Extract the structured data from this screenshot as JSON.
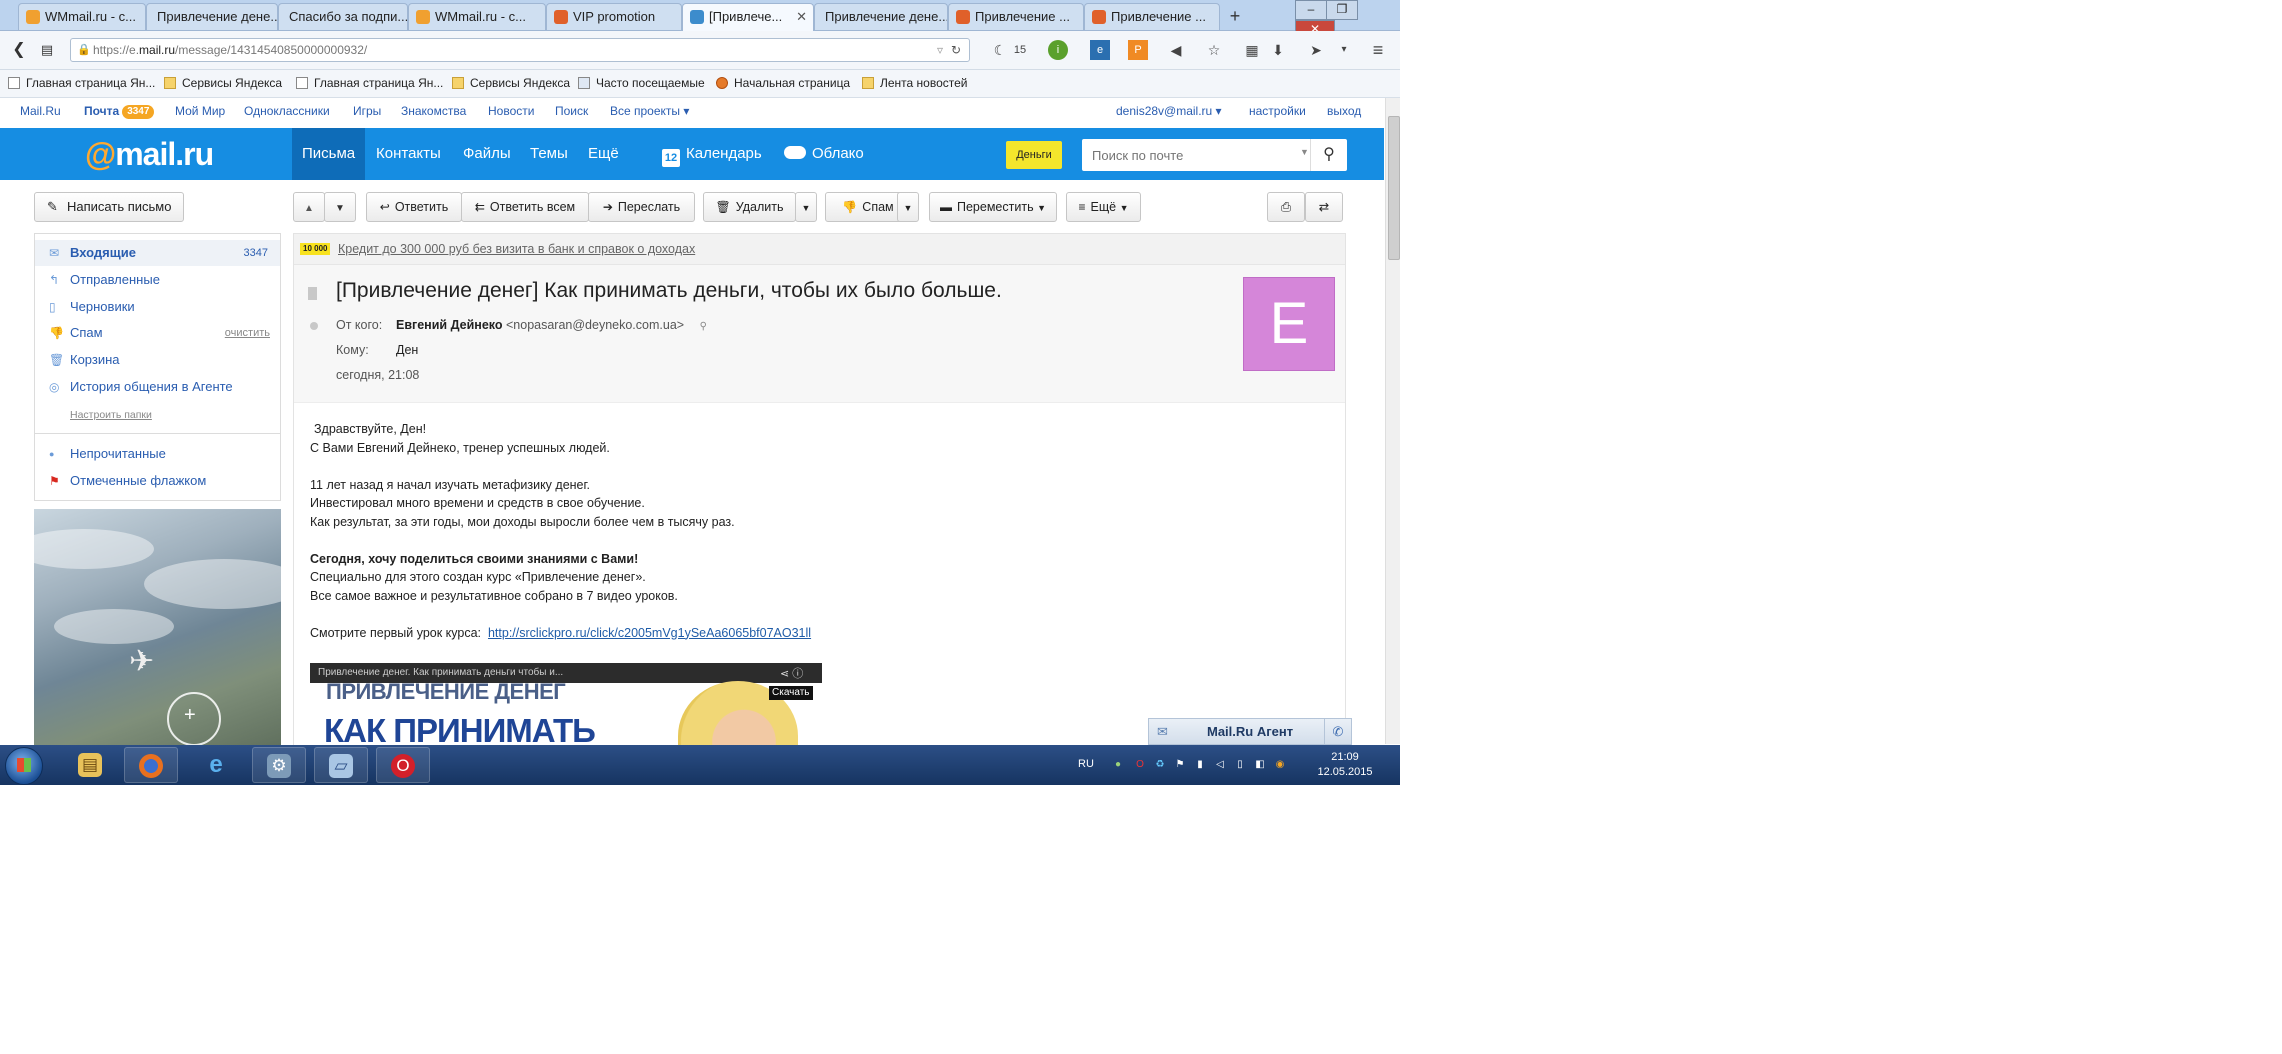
{
  "browser": {
    "tabs": [
      {
        "title": "WMmail.ru - с...",
        "color": "#f0a030"
      },
      {
        "title": "Привлечение дене...",
        "color": ""
      },
      {
        "title": "Спасибо за подпи...",
        "color": ""
      },
      {
        "title": "WMmail.ru - с...",
        "color": "#f0a030"
      },
      {
        "title": "VIP promotion",
        "color": "#e0602a"
      },
      {
        "title": "[Привлече...",
        "color": "#3c8ccc"
      },
      {
        "title": "Привлечение дене...",
        "color": ""
      },
      {
        "title": "Привлечение ...",
        "color": "#e0602a"
      },
      {
        "title": "Привлечение ...",
        "color": "#e0602a"
      }
    ],
    "new_tab_label": "+",
    "url_prefix": "https://e.",
    "url_domain": "mail.ru",
    "url_rest": "/message/14314540850000000932/",
    "weather_temp": "15",
    "bookmarks": [
      "Главная страница Ян...",
      "Сервисы Яндекса",
      "Главная страница Ян...",
      "Сервисы Яндекса",
      "Часто посещаемые",
      "Начальная страница",
      "Лента новостей"
    ]
  },
  "portal": {
    "links": [
      "Mail.Ru",
      "Почта",
      "Мой Мир",
      "Одноклассники",
      "Игры",
      "Знакомства",
      "Новости",
      "Поиск",
      "Все проекты ▾"
    ],
    "mail_count": "3347",
    "user": "denis28v@mail.ru ▾",
    "settings": "настройки",
    "logout": "выход"
  },
  "header": {
    "logo_at": "@",
    "logo_text": "mail.ru",
    "nav": [
      "Письма",
      "Контакты",
      "Файлы",
      "Темы",
      "Ещё"
    ],
    "calendar": "Календарь",
    "calendar_day": "12",
    "cloud": "Облако",
    "money": "Деньги",
    "search_placeholder": "Поиск по почте"
  },
  "toolbar": {
    "compose": "Написать письмо",
    "reply": "Ответить",
    "reply_all": "Ответить всем",
    "forward": "Переслать",
    "delete": "Удалить",
    "spam": "Спам",
    "move": "Переместить",
    "more": "Ещё"
  },
  "sidebar": {
    "folders": [
      {
        "label": "Входящие",
        "count": "3347"
      },
      {
        "label": "Отправленные"
      },
      {
        "label": "Черновики"
      },
      {
        "label": "Спам",
        "action": "очистить"
      },
      {
        "label": "Корзина"
      },
      {
        "label": "История общения в Агенте"
      }
    ],
    "configure": "Настроить папки",
    "filters": [
      "Непрочитанные",
      "Отмеченные флажком"
    ]
  },
  "message": {
    "ad_badge": "10 000",
    "ad_text": "Кредит до 300 000 руб без визита в банк и справок о доходах",
    "subject": "[Привлечение денег] Как принимать деньги, чтобы их было больше.",
    "from_label": "От кого:",
    "from_name": "Евгений Дейнеко",
    "from_email": "<nopasaran@deyneko.com.ua>",
    "to_label": "Кому:",
    "to_name": "Ден",
    "date": "сегодня, 21:08",
    "avatar_letter": "E",
    "avatar_color": "#d586d9",
    "body": {
      "greeting": "Здравствуйте, Ден!",
      "intro": "С Вами Евгений Дейнеко, тренер успешных людей.",
      "p1_1": "11 лет назад я начал изучать метафизику денег.",
      "p1_2": "Инвестировал много времени и средств в свое обучение.",
      "p1_3": "Как результат, за эти годы, мои доходы выросли более чем в тысячу раз.",
      "bold": "Сегодня, хочу поделиться своими знаниями с Вами!",
      "p2_1": "Специально для этого создан курс «Привлечение денег».",
      "p2_2": "Все самое важное и результативное собрано в 7 видео уроков.",
      "link_label": "Смотрите первый урок курса:",
      "link": "http://srclickpro.ru/click/c2005mVg1ySeAa6065bf07AO31ll"
    },
    "video": {
      "title": "Привлечение денег. Как принимать деньги чтобы и...",
      "line1": "ПРИВЛЕЧЕНИЕ ДЕНЕГ",
      "line2": "КАК ПРИНИМАТЬ",
      "download": "Скачать"
    }
  },
  "agent": {
    "label": "Mail.Ru Агент"
  },
  "taskbar": {
    "lang": "RU",
    "time": "21:09",
    "date": "12.05.2015"
  }
}
